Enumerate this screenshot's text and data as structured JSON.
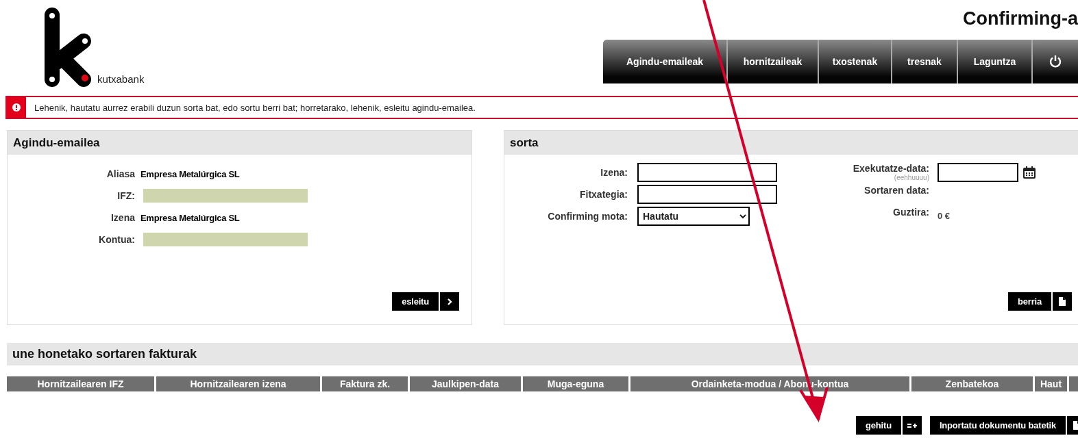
{
  "logo": {
    "brand": "kutxabank"
  },
  "title": "Confirming-a",
  "nav": [
    {
      "label": "Agindu-emaileak"
    },
    {
      "label": "hornitzaileak"
    },
    {
      "label": "txostenak"
    },
    {
      "label": "tresnak"
    },
    {
      "label": "Laguntza"
    }
  ],
  "alert": {
    "message": "Lehenik, hautatu aurrez erabili duzun sorta bat, edo sortu berri bat; horretarako, lehenik, esleitu agindu-emailea."
  },
  "payer_panel": {
    "title": "Agindu-emailea",
    "fields": [
      {
        "label": "Aliasa",
        "value": "Empresa Metalúrgica SL",
        "redacted": false
      },
      {
        "label": "IFZ:",
        "redacted": true
      },
      {
        "label": "Izena",
        "value": "Empresa Metalúrgica SL",
        "redacted": false
      },
      {
        "label": "Kontua:",
        "redacted": true
      }
    ],
    "button": "esleitu"
  },
  "batch_panel": {
    "title": "sorta",
    "left_fields": [
      {
        "label": "Izena:",
        "kind": "input"
      },
      {
        "label": "Fitxategia:",
        "kind": "input"
      },
      {
        "label": "Confirming mota:",
        "kind": "select",
        "value": "Hautatu"
      }
    ],
    "right_fields": [
      {
        "label": "Exekutatze-data:",
        "hint": "(eehhuuuu)",
        "kind": "date"
      },
      {
        "label": "Sortaren data:",
        "kind": "text"
      },
      {
        "label": "Guztira:",
        "kind": "text",
        "value": "0 €"
      }
    ],
    "button": "berria"
  },
  "invoices": {
    "title": "une honetako sortaren fakturak",
    "columns": [
      "Hornitzailearen IFZ",
      "Hornitzailearen izena",
      "Faktura zk.",
      "Jaulkipen-data",
      "Muga-eguna",
      "Ordainketa-modua / Abonu-kontua",
      "Zenbatekoa",
      "Haut"
    ],
    "buttons": [
      {
        "label": "gehitu",
        "kind": "add-list"
      },
      {
        "label": "Inportatu dokumentu batetik",
        "kind": "document"
      }
    ]
  }
}
